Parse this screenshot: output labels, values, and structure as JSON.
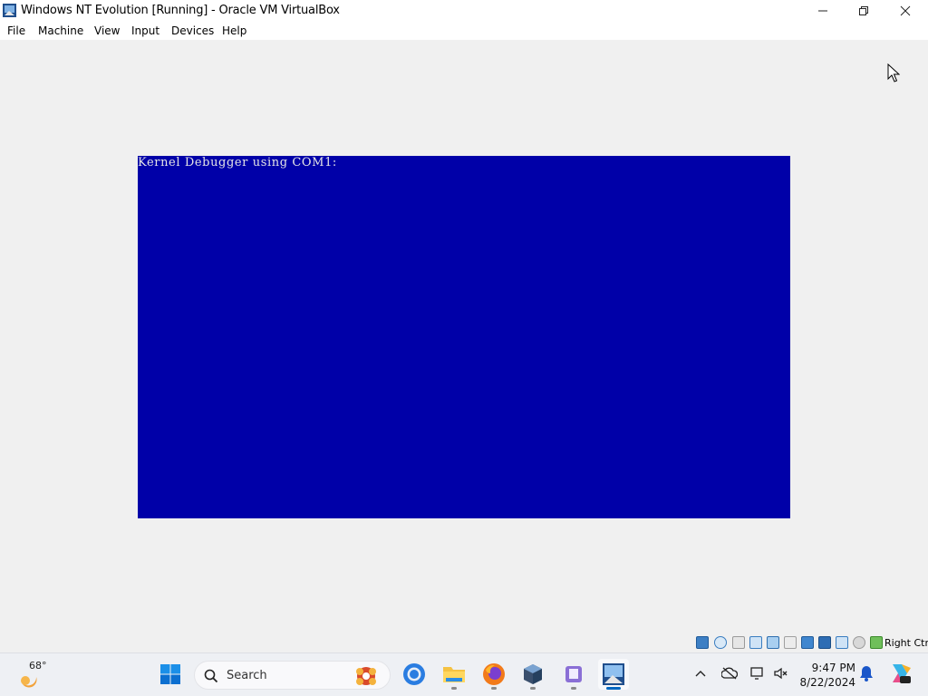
{
  "window": {
    "title": "Windows NT Evolution [Running] - Oracle VM VirtualBox",
    "icon": "virtualbox-icon"
  },
  "menu": {
    "items": [
      {
        "label": "File"
      },
      {
        "label": "Machine"
      },
      {
        "label": "View"
      },
      {
        "label": "Input"
      },
      {
        "label": "Devices"
      },
      {
        "label": "Help"
      }
    ]
  },
  "guest": {
    "background": "#0000a8",
    "console_text": "Kernel Debugger using COM1:"
  },
  "statusbar": {
    "icons": [
      "hard-disk-icon",
      "optical-drive-icon",
      "floppy-icon",
      "audio-icon",
      "network-icon",
      "usb-icon",
      "shared-folders-icon",
      "display-icon",
      "recording-icon",
      "cpu-icon",
      "mouse-integration-icon",
      "keyboard-icon"
    ],
    "host_key": "Right Ctrl"
  },
  "taskbar": {
    "weather_temp": "68°",
    "search_placeholder": "Search",
    "apps": [
      "start-icon",
      "chrome-icon",
      "file-explorer-icon",
      "firefox-icon",
      "virtualbox-icon",
      "notes-app-icon",
      "virtualbox-vm-icon"
    ],
    "time": "9:47 PM",
    "date": "8/22/2024"
  },
  "colors": {
    "guest_blue": "#0000a8",
    "accent": "#0067c0"
  }
}
